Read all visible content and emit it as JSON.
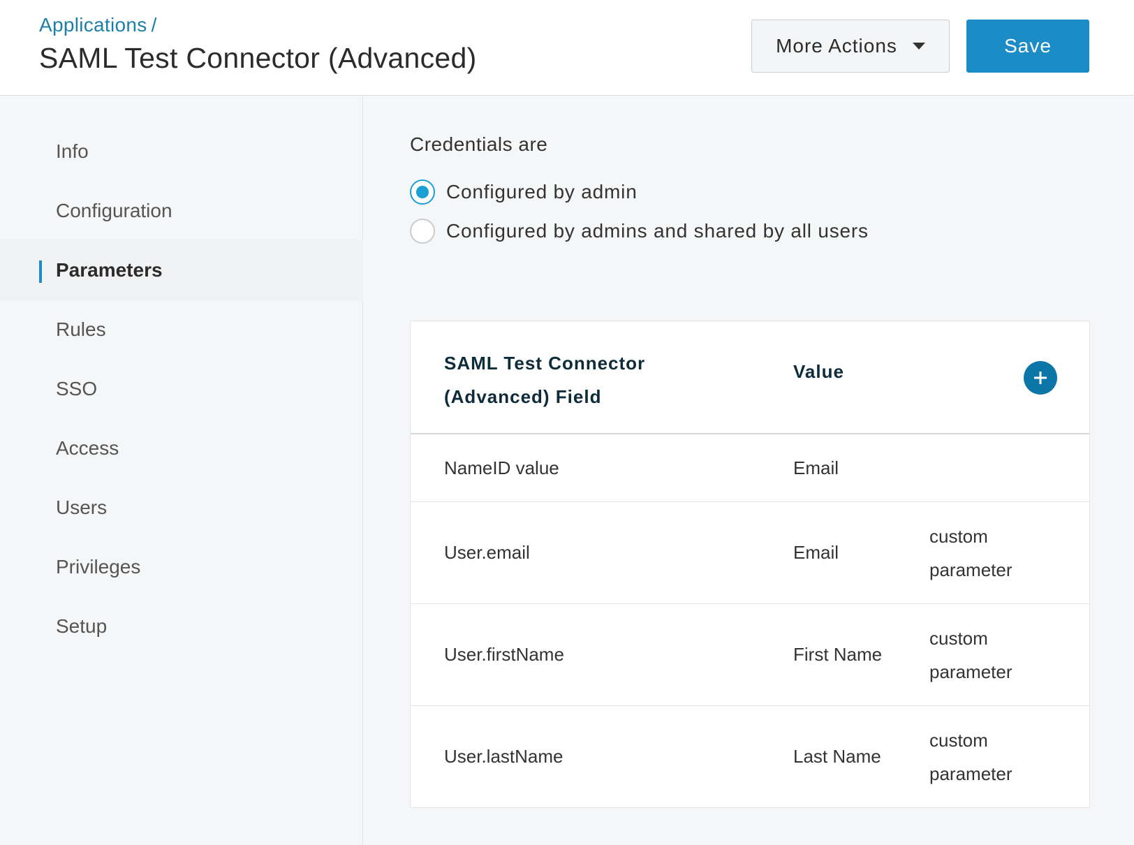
{
  "header": {
    "breadcrumb": "Applications",
    "breadcrumb_sep": "/",
    "title": "SAML Test Connector (Advanced)",
    "more_actions_label": "More Actions",
    "save_label": "Save"
  },
  "sidebar": {
    "items": [
      {
        "label": "Info"
      },
      {
        "label": "Configuration"
      },
      {
        "label": "Parameters",
        "active": true
      },
      {
        "label": "Rules"
      },
      {
        "label": "SSO"
      },
      {
        "label": "Access"
      },
      {
        "label": "Users"
      },
      {
        "label": "Privileges"
      },
      {
        "label": "Setup"
      }
    ]
  },
  "credentials": {
    "label": "Credentials are",
    "options": [
      {
        "label": "Configured by admin",
        "selected": true
      },
      {
        "label": "Configured by admins and shared by all users",
        "selected": false
      }
    ]
  },
  "table": {
    "headers": {
      "field": "SAML Test Connector (Advanced) Field",
      "value": "Value"
    },
    "rows": [
      {
        "field": "NameID value",
        "value": "Email",
        "note": ""
      },
      {
        "field": "User.email",
        "value": "Email",
        "note": "custom parameter"
      },
      {
        "field": "User.firstName",
        "value": "First Name",
        "note": "custom parameter"
      },
      {
        "field": "User.lastName",
        "value": "Last Name",
        "note": "custom parameter"
      }
    ]
  },
  "colors": {
    "accent": "#1b8cc6",
    "link": "#1c7fa8",
    "add_button": "#0d76a8",
    "radio": "#1ba0d6"
  },
  "icons": {
    "more_actions": "caret-down-icon",
    "add": "plus-icon"
  }
}
